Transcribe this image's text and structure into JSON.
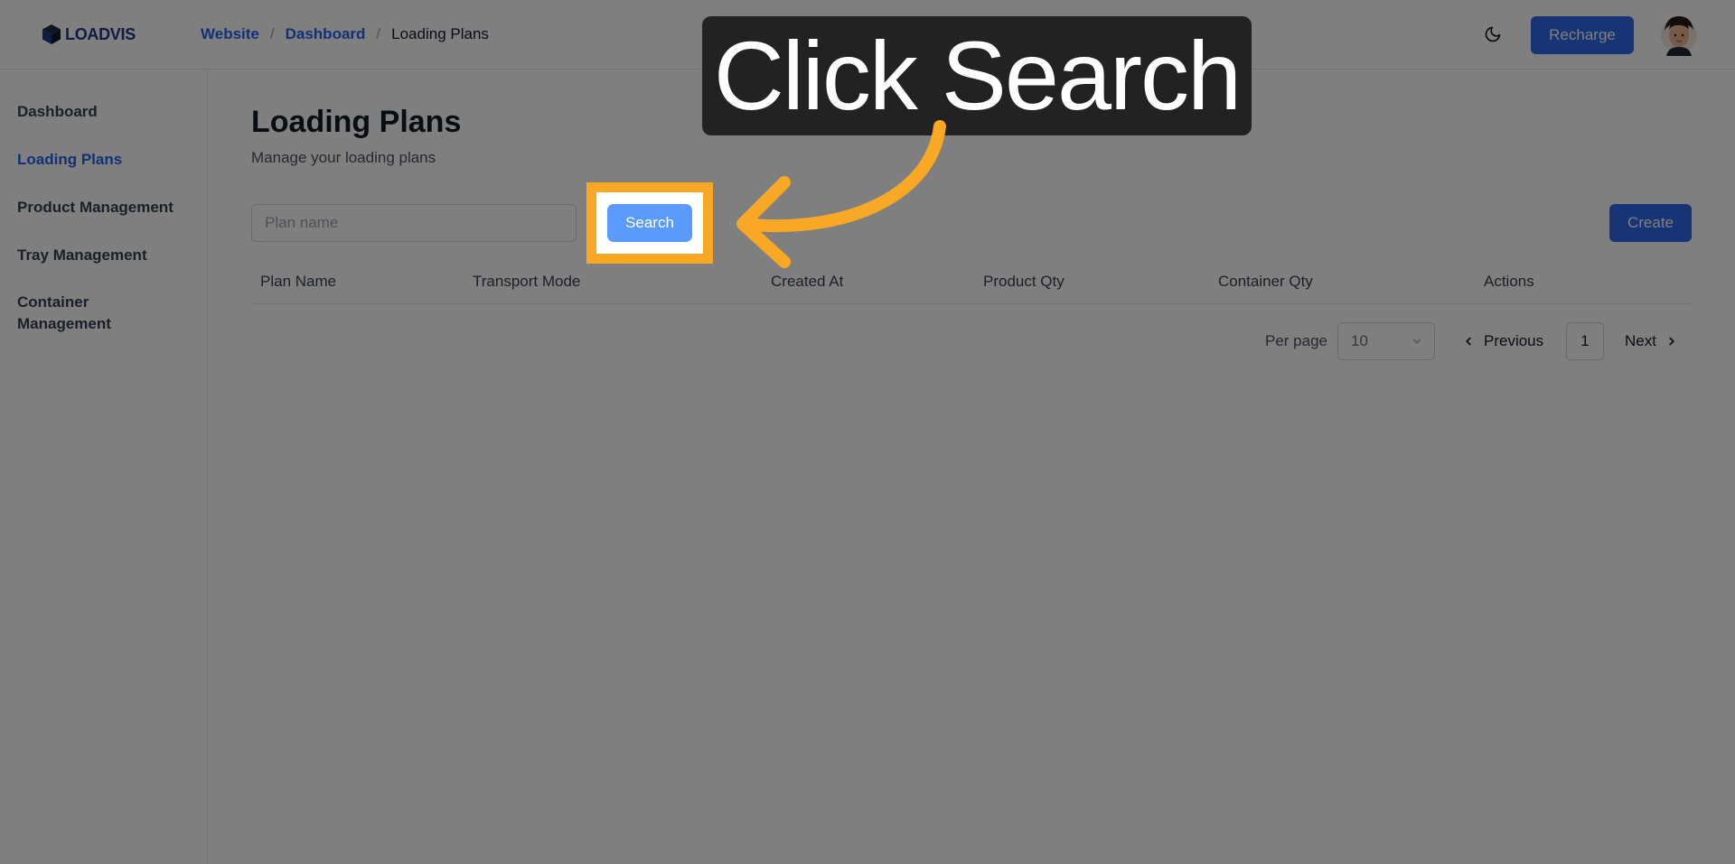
{
  "header": {
    "logo_text": "LOADVIS",
    "breadcrumb": [
      {
        "label": "Website"
      },
      {
        "label": "Dashboard"
      },
      {
        "label": "Loading Plans"
      }
    ],
    "recharge_label": "Recharge"
  },
  "sidebar": {
    "items": [
      {
        "label": "Dashboard",
        "active": false
      },
      {
        "label": "Loading Plans",
        "active": true
      },
      {
        "label": "Product Management",
        "active": false
      },
      {
        "label": "Tray Management",
        "active": false
      },
      {
        "label": "Container Management",
        "active": false
      }
    ]
  },
  "main": {
    "title": "Loading Plans",
    "subtitle": "Manage your loading plans",
    "search": {
      "placeholder": "Plan name",
      "value": ""
    },
    "search_label": "Search",
    "create_label": "Create",
    "table": {
      "columns": [
        "Plan Name",
        "Transport Mode",
        "Created At",
        "Product Qty",
        "Container Qty",
        "Actions"
      ],
      "rows": []
    },
    "pagination": {
      "per_page_label": "Per page",
      "per_page_value": "10",
      "previous_label": "Previous",
      "current_page": "1",
      "next_label": "Next"
    }
  },
  "overlay": {
    "callout_text": "Click Search",
    "accent_color": "#f9a825"
  }
}
